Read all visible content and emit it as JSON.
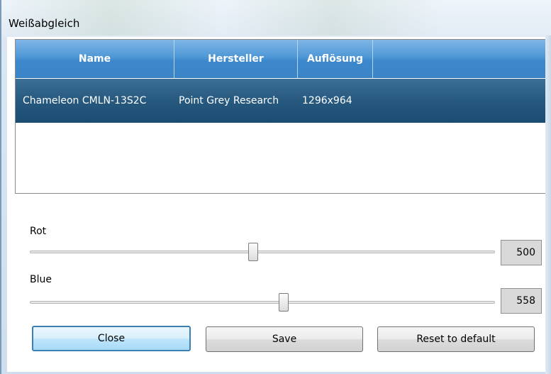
{
  "window": {
    "title": "Weißabgleich"
  },
  "table": {
    "columns": [
      "Name",
      "Hersteller",
      "Auflösung"
    ],
    "rows": [
      {
        "name": "Chameleon CMLN-13S2C",
        "hersteller": "Point Grey Research",
        "aufloesung": "1296x964"
      }
    ]
  },
  "sliders": {
    "rot": {
      "label": "Rot",
      "value": "500",
      "fraction": 0.48
    },
    "blue": {
      "label": "Blue",
      "value": "558",
      "fraction": 0.545
    }
  },
  "buttons": {
    "close": "Close",
    "save": "Save",
    "reset": "Reset to default"
  },
  "colors": {
    "header": "#4f97d6",
    "selected_row": "#27597f",
    "default_button_border": "#3c7fb1"
  }
}
